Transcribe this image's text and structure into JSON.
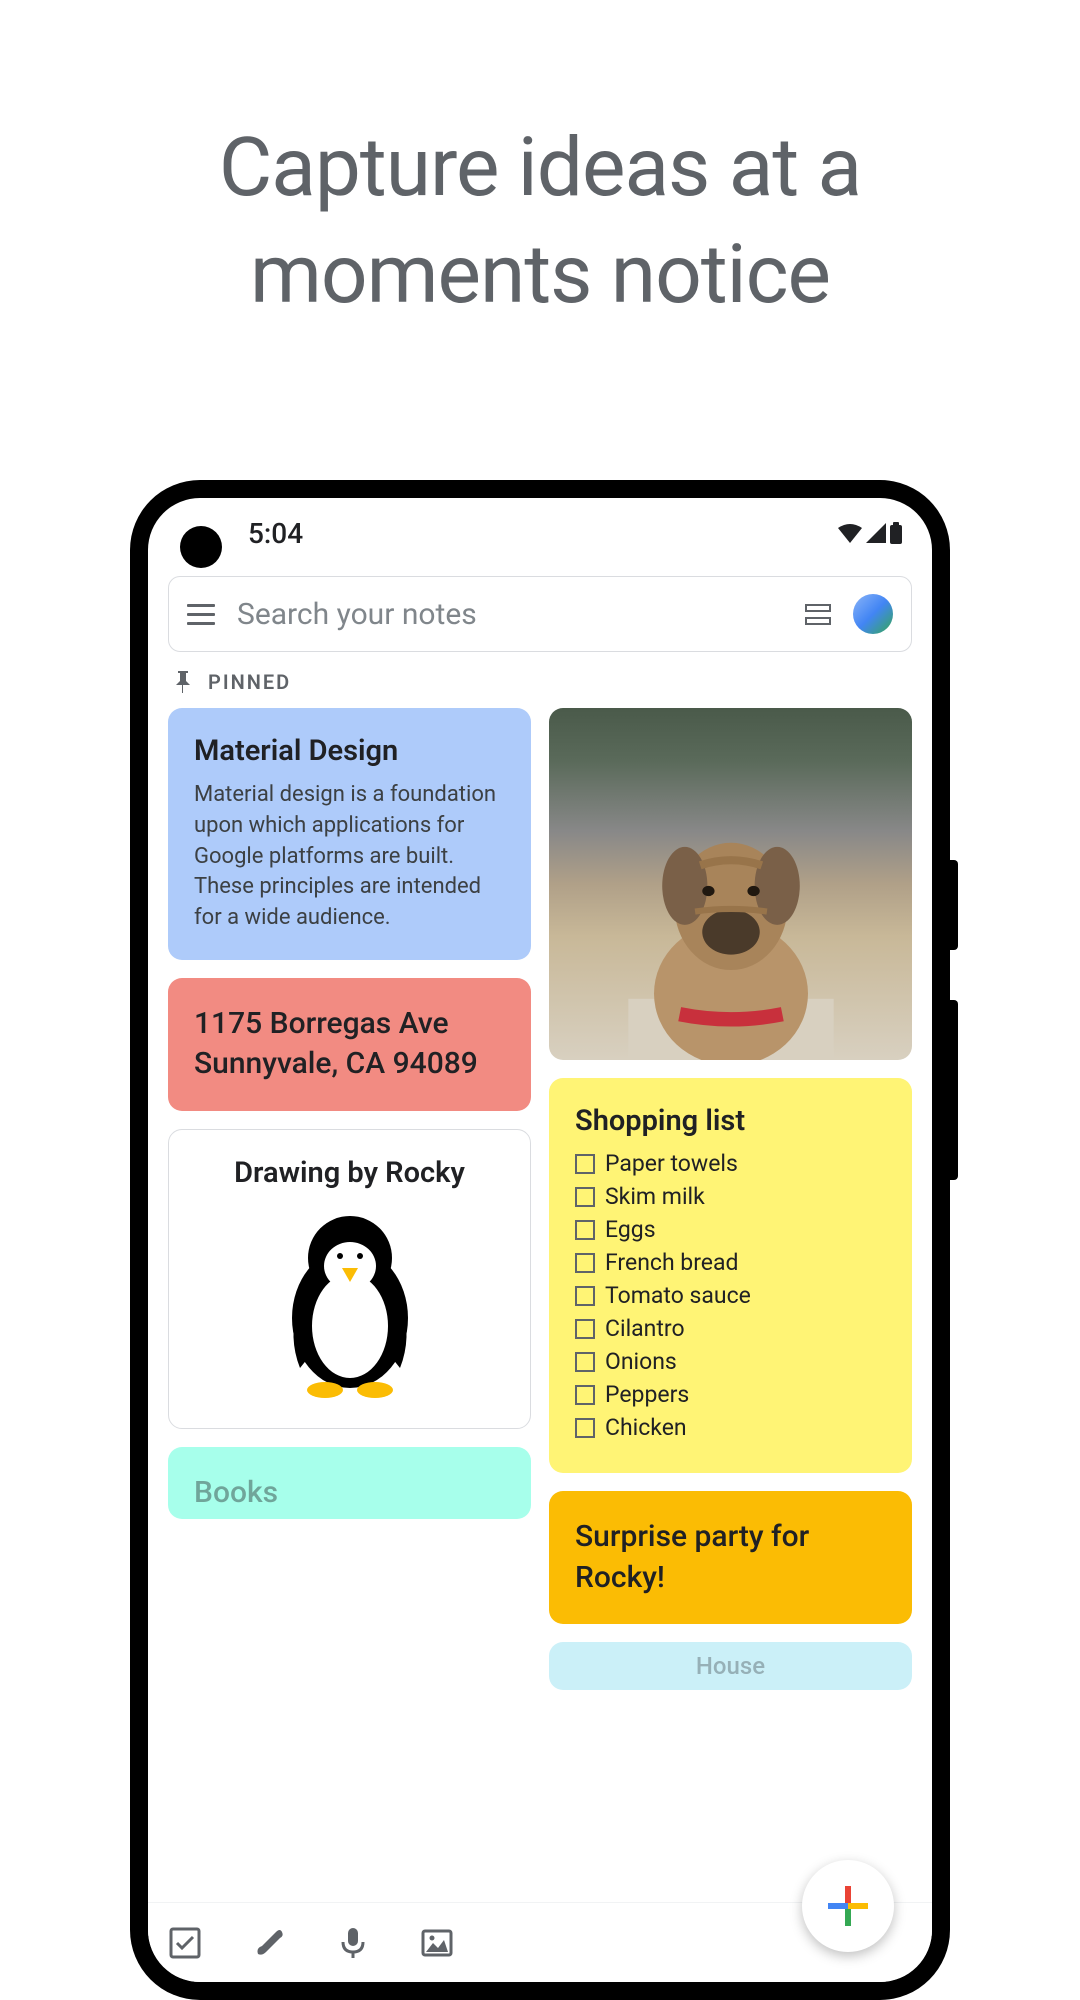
{
  "headline": "Capture ideas at a moments notice",
  "status": {
    "time": "5:04",
    "icons": [
      "wifi",
      "signal",
      "battery"
    ]
  },
  "search": {
    "placeholder": "Search your notes"
  },
  "pinned_label": "PINNED",
  "notes": {
    "material_design": {
      "title": "Material Design",
      "body": "Material design is a foundation upon which applications for Google platforms are built. These principles are intended for a wide audience."
    },
    "address": {
      "text": "1175 Borregas Ave Sunnyvale, CA 94089"
    },
    "drawing": {
      "title": "Drawing by Rocky"
    },
    "books": {
      "title": "Books"
    },
    "shopping": {
      "title": "Shopping list",
      "items": [
        "Paper towels",
        "Skim milk",
        "Eggs",
        "French bread",
        "Tomato sauce",
        "Cilantro",
        "Onions",
        "Peppers",
        "Chicken"
      ]
    },
    "party": {
      "title": "Surprise party for Rocky!"
    },
    "house": {
      "title": "House"
    }
  },
  "bottom_actions": [
    "checklist",
    "brush",
    "microphone",
    "image"
  ],
  "colors": {
    "blue": "#aecbfa",
    "red": "#f28b82",
    "yellow": "#fff475",
    "orange": "#fbbc04",
    "teal": "#a7ffeb",
    "lightblue": "#cbf0f8"
  }
}
